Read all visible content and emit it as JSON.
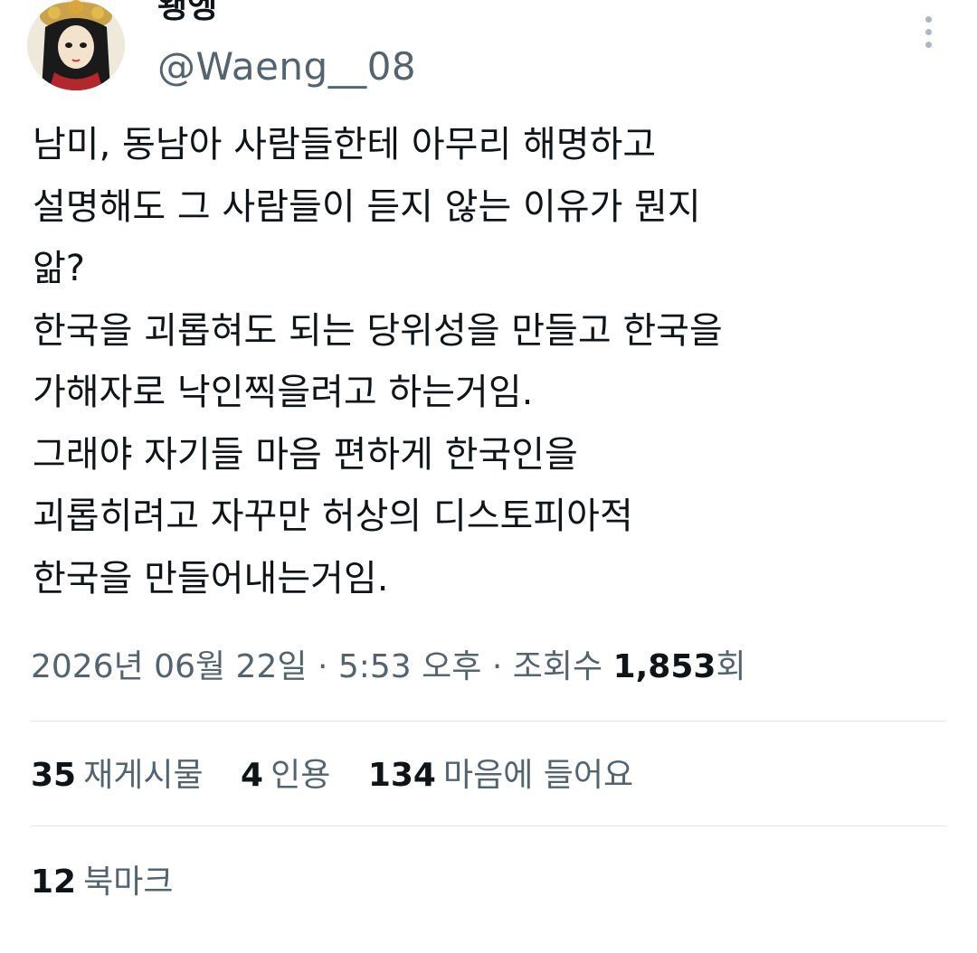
{
  "tweet": {
    "display_name": "왱엥",
    "handle": "@Waeng__08",
    "text": "남미, 동남아 사람들한테 아무리 해명하고\n설명해도 그 사람들이 듣지 않는 이유가 뭔지\n앎?\n한국을 괴롭혀도 되는 당위성을 만들고 한국을\n가해자로 낙인찍을려고 하는거임.\n그래야 자기들 마음 편하게 한국인을\n괴롭히려고 자꾸만 허상의 디스토피아적\n한국을 만들어내는거임.",
    "date": "2026년 06월 22일",
    "time": "5:53 오후",
    "views_label": "조회수",
    "views_count": "1,853",
    "views_suffix": "회",
    "separator": "·"
  },
  "stats": {
    "retweets_count": "35",
    "retweets_label": "재게시물",
    "quotes_count": "4",
    "quotes_label": "인용",
    "likes_count": "134",
    "likes_label": "마음에 들어요",
    "bookmarks_count": "12",
    "bookmarks_label": "북마크"
  },
  "colors": {
    "text_primary": "#0f1419",
    "text_secondary": "#536471",
    "divider": "#e1e8ed"
  },
  "icons": {
    "more": "more-vertical-icon"
  }
}
